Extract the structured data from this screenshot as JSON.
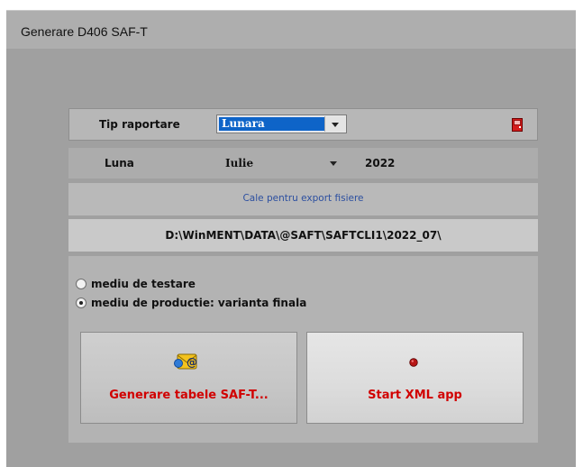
{
  "window": {
    "title": "Generare D406 SAF-T"
  },
  "tip": {
    "label": "Tip raportare",
    "value": "Lunara"
  },
  "luna": {
    "label": "Luna",
    "value": "Iulie",
    "year": "2022"
  },
  "export": {
    "caption": "Cale pentru export fisiere",
    "path": "D:\\WinMENT\\DATA\\@SAFT\\SAFTCLI1\\2022_07\\"
  },
  "mode": {
    "options": [
      "mediu de testare",
      "mediu de productie: varianta finala"
    ],
    "selected": "mediu de productie: varianta finala"
  },
  "actions": {
    "generate_label": "Generare tabele SAF-T...",
    "start_label": "Start XML app"
  },
  "icons": {
    "exit": "exit-door-icon",
    "generate": "email-at-icon",
    "start": "record-dot-icon"
  },
  "colors": {
    "selection": "#0e64c8",
    "action_text": "#d10000",
    "caption_text": "#2c4fa0"
  }
}
